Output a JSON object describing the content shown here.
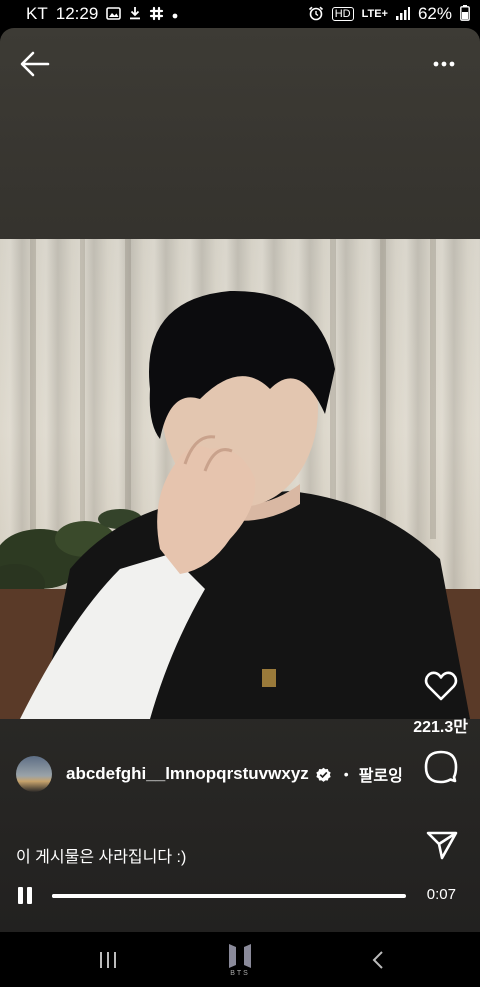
{
  "status_bar": {
    "carrier": "KT",
    "time": "12:29",
    "network": "LTE+",
    "hd_badge": "HD",
    "battery": "62%",
    "icons": [
      "gallery-icon",
      "download-icon",
      "slack-icon",
      "dot-icon",
      "alarm-icon",
      "signal-icon"
    ]
  },
  "header": {
    "back_icon": "arrow-left-icon",
    "more_icon": "more-horizontal-icon"
  },
  "actions": {
    "like_icon": "heart-outline-icon",
    "like_count": "221.3만",
    "comment_icon": "comment-bubble-icon",
    "share_icon": "paper-plane-icon"
  },
  "post": {
    "username": "abcdefghi__lmnopqrstuvwxyz",
    "verified": true,
    "separator": "•",
    "follow_label": "팔로잉",
    "caption": "이 게시물은 사라집니다 :)"
  },
  "player": {
    "state_icon": "pause-icon",
    "progress": 0.98,
    "time": "0:07"
  },
  "nav": {
    "recents_icon": "recents-icon",
    "home_logo_text": "BTS",
    "back_icon": "nav-back-icon"
  },
  "colors": {
    "background": "#000000",
    "card_top": "#3d3b35",
    "card_bottom": "#222120",
    "text": "#ffffff"
  }
}
